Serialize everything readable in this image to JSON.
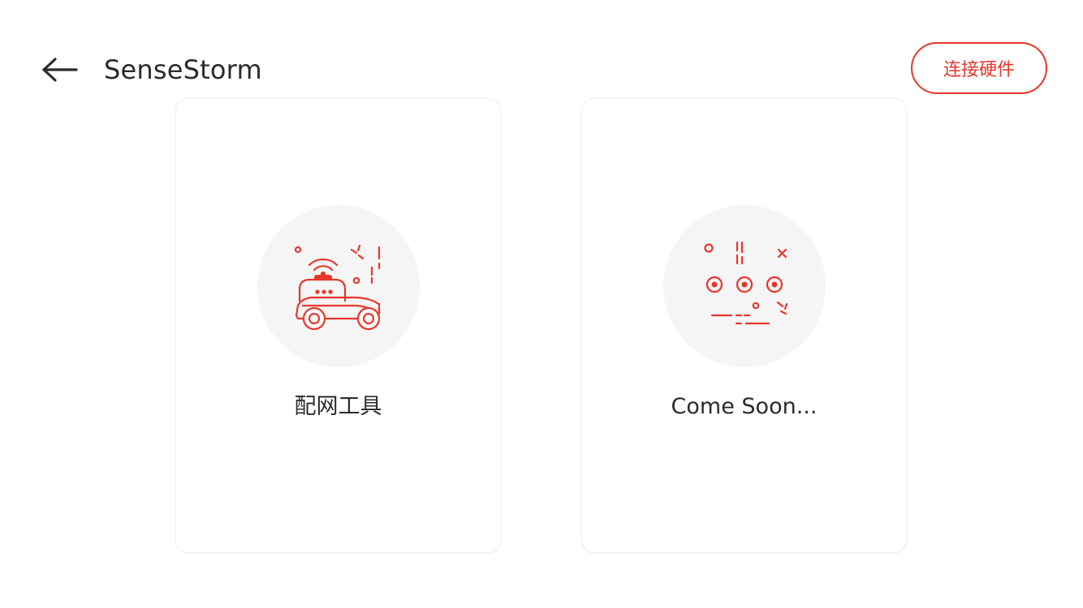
{
  "header": {
    "title": "SenseStorm",
    "connect_label": "连接硬件"
  },
  "cards": [
    {
      "label": "配网工具",
      "icon": "robot-car-wifi-icon"
    },
    {
      "label": "Come Soon...",
      "icon": "coming-soon-dots-icon"
    }
  ],
  "colors": {
    "accent": "#e8362b",
    "circle_bg": "#f5f5f5",
    "text": "#2b2b2b"
  }
}
